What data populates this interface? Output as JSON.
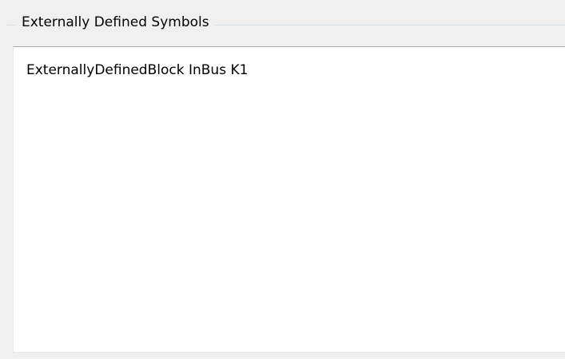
{
  "group": {
    "title": "Externally Defined Symbols"
  },
  "text_area": {
    "value": "ExternallyDefinedBlock InBus K1"
  },
  "colors": {
    "background": "#f0f0f0",
    "text_area_background": "#ffffff",
    "group_border": "#d5dfe5",
    "text_area_border": "#abadb3"
  }
}
